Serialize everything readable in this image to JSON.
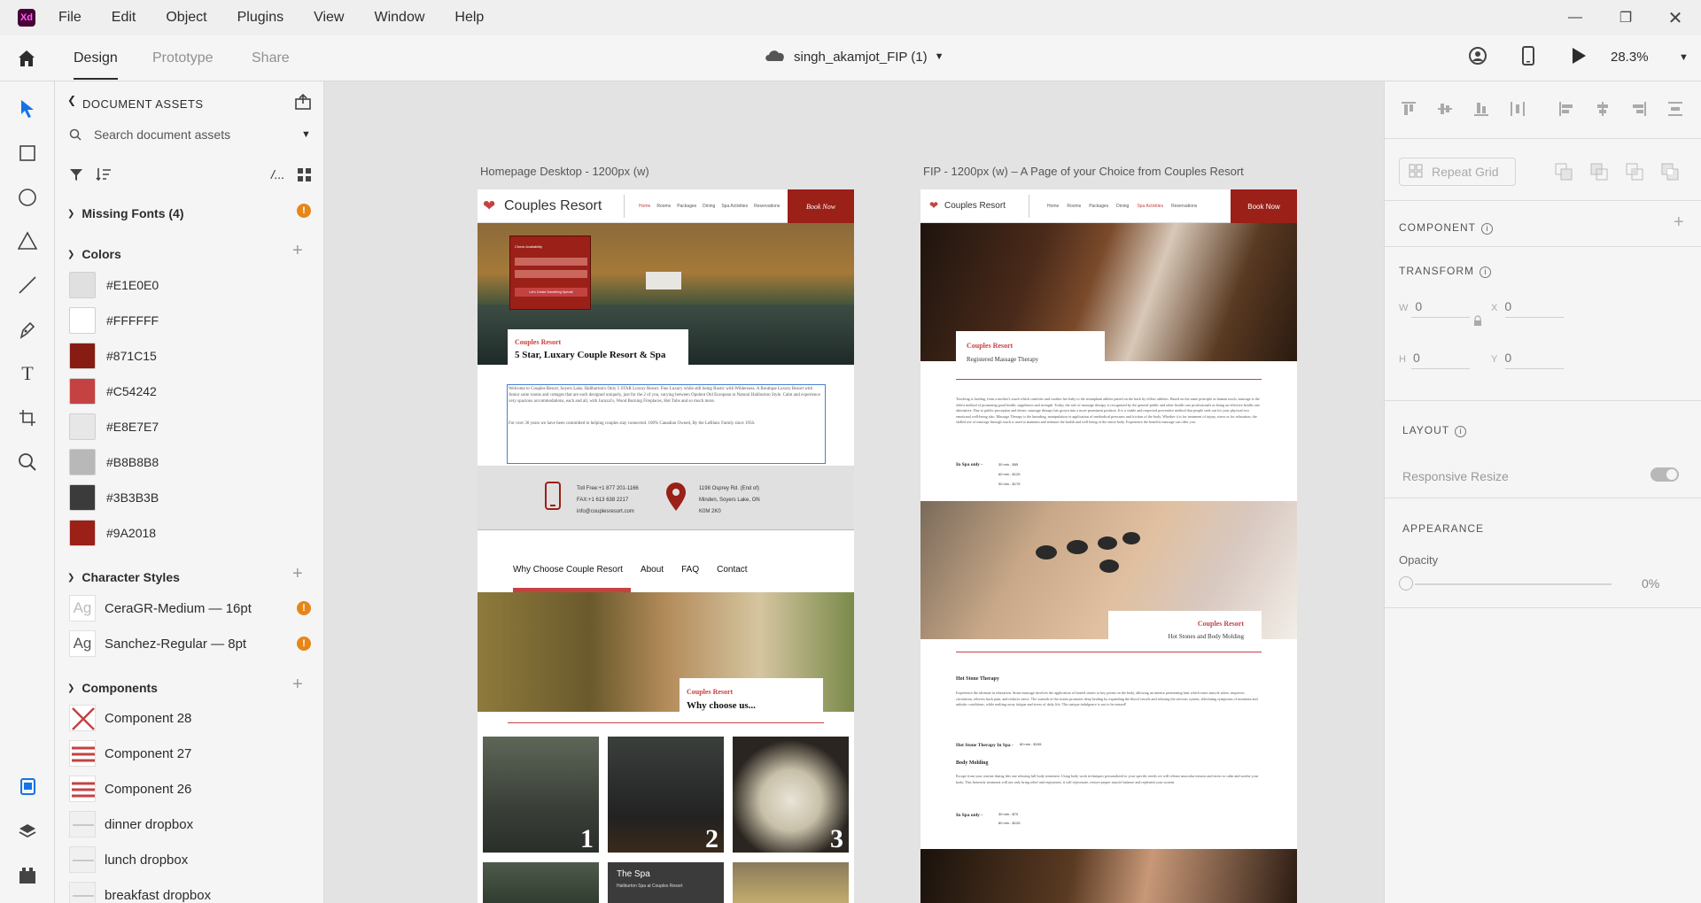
{
  "app": {
    "logo": "Xd"
  },
  "menu": [
    "File",
    "Edit",
    "Object",
    "Plugins",
    "View",
    "Window",
    "Help"
  ],
  "toolbar": {
    "tabs": [
      "Design",
      "Prototype",
      "Share"
    ],
    "doc_title": "singh_akamjot_FIP (1)",
    "zoom": "28.3%"
  },
  "assets": {
    "header": "DOCUMENT ASSETS",
    "search_placeholder": "Search document assets",
    "missing_fonts": "Missing Fonts (4)",
    "colors_title": "Colors",
    "colors": [
      {
        "hex": "#E1E0E0"
      },
      {
        "hex": "#FFFFFF"
      },
      {
        "hex": "#871C15"
      },
      {
        "hex": "#C54242"
      },
      {
        "hex": "#E8E7E7"
      },
      {
        "hex": "#B8B8B8"
      },
      {
        "hex": "#3B3B3B"
      },
      {
        "hex": "#9A2018"
      }
    ],
    "char_styles_title": "Character Styles",
    "char_styles": [
      {
        "label": "CeraGR-Medium — 16pt",
        "glyph": "Ag"
      },
      {
        "label": "Sanchez-Regular — 8pt",
        "glyph": "Ag"
      }
    ],
    "components_title": "Components",
    "components": [
      {
        "label": "Component 28",
        "icon": "red-x"
      },
      {
        "label": "Component 27",
        "icon": "red-lines"
      },
      {
        "label": "Component 26",
        "icon": "red-lines"
      },
      {
        "label": "dinner dropbox",
        "icon": "dropbox"
      },
      {
        "label": "lunch dropbox",
        "icon": "dropbox"
      },
      {
        "label": "breakfast dropbox",
        "icon": "dropbox"
      }
    ]
  },
  "canvas": {
    "artboard1": {
      "label": "Homepage Desktop - 1200px (w)",
      "brand": "Couples Resort",
      "nav": [
        "Home",
        "Rooms",
        "Packages",
        "Dining",
        "Spa Activities",
        "Reservations"
      ],
      "book_now": "Book Now",
      "availability_title": "Check Availability",
      "availability_btn": "Let's Create Something Special",
      "hero_card_kicker": "Couples Resort",
      "hero_card_title": "5 Star, Luxary Couple Resort & Spa",
      "intro_p1": "Welcome to Couples Resort, Soyers Lake, Haliburton's Only 5 STAR Luxury Resort. Fine Luxury while still being Rustic with Wilderness. A Boutique Luxury Resort with Junior suite rooms and cottages that are each designed uniquely, just for the 2 of you, varying between Opulent Old European to Natural Haliburton Style. Calm and experience very spacious accommodations, each and all, with Jacuzzi's, Wood Burning Fireplaces, Hot Tubs and so much more.",
      "intro_p2": "For over 30 years we have been committed to helping couples stay connected. 100% Canadian Owned, By the LeBlanc Family since 1956.",
      "contact_phone": "Toll Free:+1 877 201-1166",
      "contact_fax": "FAX:+1 613 638 2217",
      "contact_email": "info@couplesresort.com",
      "address_1": "1198 Osprey Rd. (End of)",
      "address_2": "Minden, Soyers Lake, ON",
      "address_3": "K0M 2K0",
      "subnav": [
        "Why Choose Couple Resort",
        "About",
        "FAQ",
        "Contact"
      ],
      "why_kicker": "Couples Resort",
      "why_title": "Why choose us...",
      "tiles": [
        "1",
        "2",
        "3"
      ],
      "spa_tile_title": "The Spa",
      "spa_tile_sub": "Haliburton Spa at Couples Resort"
    },
    "artboard2": {
      "label": "FIP - 1200px (w) –  A Page of your Choice from Couples Resort",
      "brand": "Couples Resort",
      "nav": [
        "Home",
        "Rooms",
        "Packages",
        "Dining",
        "Spa Activities",
        "Reservations"
      ],
      "book_now": "Book Now",
      "massage_kicker": "Couples Resort",
      "massage_title": "Registered Massage Therapy",
      "massage_text": "Touching is healing, from a mother's touch which comforts and soothes her baby to the triumphant athlete patted on the back by fellow athletes. Based on the same principle as human touch, massage is the oldest method of promoting good health, suppleness and strength. Today, the role of massage therapy is recognized by the general public and other health care professionals as being an effective health care alternative. Due to public perception and desire, massage therapy has grown into a more prominent position. It is a viable and respected preventive method that people seek out for your physical two emotional well-being also. Massage Therapy is the kneading, manipulation or application of methodical pressures and friction of the body. Whether it is for treatment of injury, stress or for relaxation, the skilled use of massage through touch is used to maintain and enhance the health and well being of the entire body. Experience the benefits massage can offer you.",
      "inspa_label": "In Spa only -",
      "inspa_prices": [
        "30 min - $65",
        "60 min - $125",
        "90 min - $175"
      ],
      "stones_kicker": "Couples Resort",
      "stones_title": "Hot Stones and Body Molding",
      "hst_heading": "Hot Stone Therapy",
      "hst_text": "Experience the ultimate in relaxation. Stone massage involves the application of heated stones to key points on the body, allowing an intense penetrating heat which eases muscle aches, improves circulation, relieves back pain, and reduces stress. The warmth of the stones promotes deep healing by expanding the blood vessels and relaxing the nervous system, alleviating symptoms of insomnia and arthritic conditions, while melting away fatigue and stress of daily life. This unique indulgence is not to be missed!",
      "hst_inspa": "Hot Stone Therapy In Spa -",
      "hst_price": "60 min - $155",
      "bm_heading": "Body Molding",
      "bm_text": "Escape from your routine during this one relaxing full body treatment. Using body work techniques personalized to your specific needs we will release muscular tension and stress to calm and soothe your body. This heavenly treatment will not only bring relief and enjoyment, it will rejuvenate, restore proper muscle balance and replenish your system.",
      "bm_inspa": "In Spa only -",
      "bm_prices": [
        "30 min - $70",
        "60 min - $125"
      ]
    }
  },
  "inspector": {
    "repeat_grid": "Repeat Grid",
    "component_label": "COMPONENT",
    "transform_label": "TRANSFORM",
    "w_key": "W",
    "w_value": "0",
    "h_key": "H",
    "h_value": "0",
    "x_key": "X",
    "x_value": "0",
    "y_key": "Y",
    "y_value": "0",
    "layout_label": "LAYOUT",
    "responsive_resize": "Responsive Resize",
    "appearance_label": "APPEARANCE",
    "opacity_label": "Opacity",
    "opacity_value": "0%"
  },
  "colors": {
    "brand_red": "#9A2018",
    "accent_red": "#C54242",
    "xd_purple": "#470137"
  }
}
